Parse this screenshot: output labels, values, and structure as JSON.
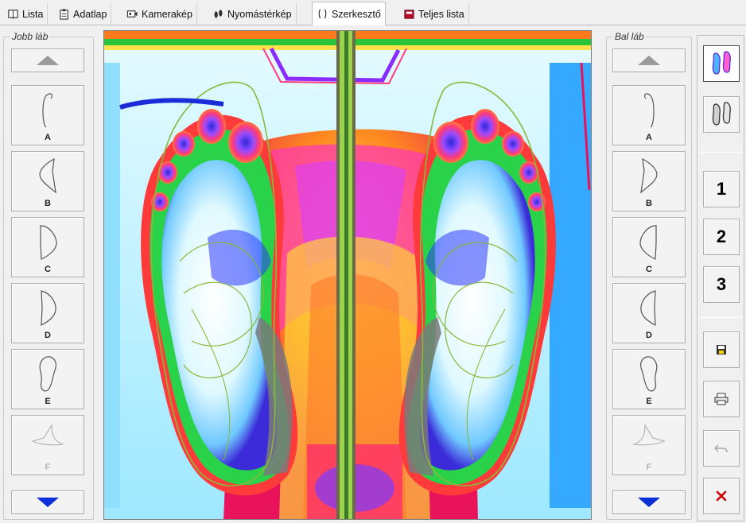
{
  "tabs": [
    {
      "label": "Lista",
      "icon": "book-icon"
    },
    {
      "label": "Adatlap",
      "icon": "clipboard-icon"
    },
    {
      "label": "Kamerakép",
      "icon": "camera-icon"
    },
    {
      "label": "Nyomástérkép",
      "icon": "footprint-icon"
    },
    {
      "label": "Szerkesztő",
      "icon": "insole-icon",
      "active": true
    },
    {
      "label": "Teljes lista",
      "icon": "folder-icon"
    }
  ],
  "right_foot": {
    "title": "Jobb láb",
    "templates": [
      {
        "letter": "A"
      },
      {
        "letter": "B"
      },
      {
        "letter": "C"
      },
      {
        "letter": "D"
      },
      {
        "letter": "E"
      },
      {
        "letter": "F",
        "disabled": true
      }
    ]
  },
  "left_foot": {
    "title": "Bal láb",
    "templates": [
      {
        "letter": "A"
      },
      {
        "letter": "B"
      },
      {
        "letter": "C"
      },
      {
        "letter": "D"
      },
      {
        "letter": "E"
      },
      {
        "letter": "F",
        "disabled": true
      }
    ]
  },
  "toolbar": {
    "view_modes": [
      "color-feet-icon",
      "gray-feet-icon"
    ],
    "numbers": [
      "1",
      "2",
      "3"
    ],
    "actions": [
      "save-icon",
      "print-icon",
      "undo-icon",
      "close-icon"
    ]
  },
  "colors": {
    "accent": "#0b2fd8",
    "close": "#d00000"
  }
}
